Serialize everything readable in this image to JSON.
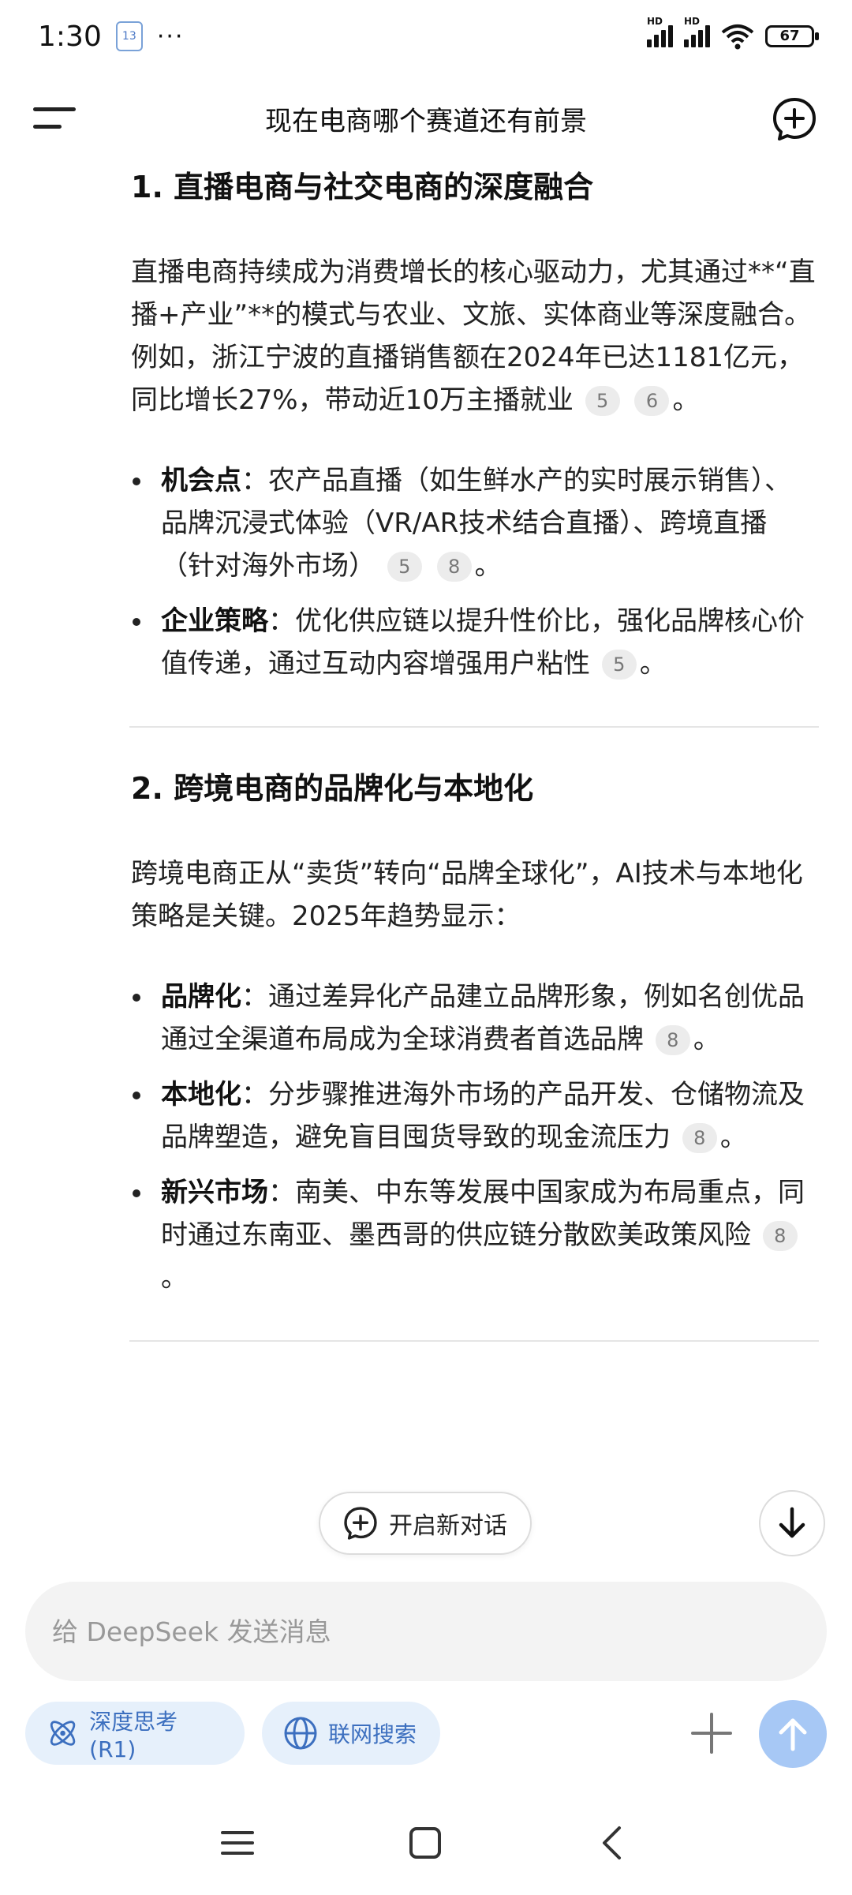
{
  "status_bar": {
    "time": "1:30",
    "calendar_badge": "13",
    "more_dots": "···",
    "hd1": "HD",
    "hd2": "HD",
    "battery": "67"
  },
  "header": {
    "title": "现在电商哪个赛道还有前景"
  },
  "sections": [
    {
      "heading": "1. 直播电商与社交电商的深度融合",
      "intro": "直播电商持续成为消费增长的核心驱动力，尤其通过**“直播+产业”**的模式与农业、文旅、实体商业等深度融合。例如，浙江宁波的直播销售额在2024年已达1181亿元，同比增长27%，带动近10万主播就业",
      "intro_refs": [
        "5",
        "6"
      ],
      "bullets": [
        {
          "label": "机会点",
          "text": "：农产品直播（如生鲜水产的实时展示销售）、品牌沉浸式体验（VR/AR技术结合直播）、跨境直播（针对海外市场）",
          "refs": [
            "5",
            "8"
          ]
        },
        {
          "label": "企业策略",
          "text": "：优化供应链以提升性价比，强化品牌核心价值传递，通过互动内容增强用户粘性",
          "refs": [
            "5"
          ]
        }
      ]
    },
    {
      "heading": "2. 跨境电商的品牌化与本地化",
      "intro": "跨境电商正从“卖货”转向“品牌全球化”，AI技术与本地化策略是关键。2025年趋势显示：",
      "intro_refs": [],
      "bullets": [
        {
          "label": "品牌化",
          "text": "：通过差异化产品建立品牌形象，例如名创优品通过全渠道布局成为全球消费者首选品牌",
          "refs": [
            "8"
          ]
        },
        {
          "label": "本地化",
          "text": "：分步骤推进海外市场的产品开发、仓储物流及品牌塑造，避免盲目囤货导致的现金流压力",
          "refs": [
            "8"
          ]
        },
        {
          "label": "新兴市场",
          "text": "：南美、中东等发展中国家成为布局重点，同时通过东南亚、墨西哥的供应链分散欧美政策风险",
          "refs": [
            "8"
          ]
        }
      ]
    }
  ],
  "period": "。",
  "floating": {
    "new_dialog_label": "开启新对话"
  },
  "input": {
    "placeholder": "给 DeepSeek 发送消息"
  },
  "chips": {
    "deep_think": "深度思考 (R1)",
    "web_search": "联网搜索"
  },
  "colors": {
    "accent": "#3c6fbf",
    "chip_bg": "#e6f0fb",
    "send_bg": "#a7c8f5"
  }
}
